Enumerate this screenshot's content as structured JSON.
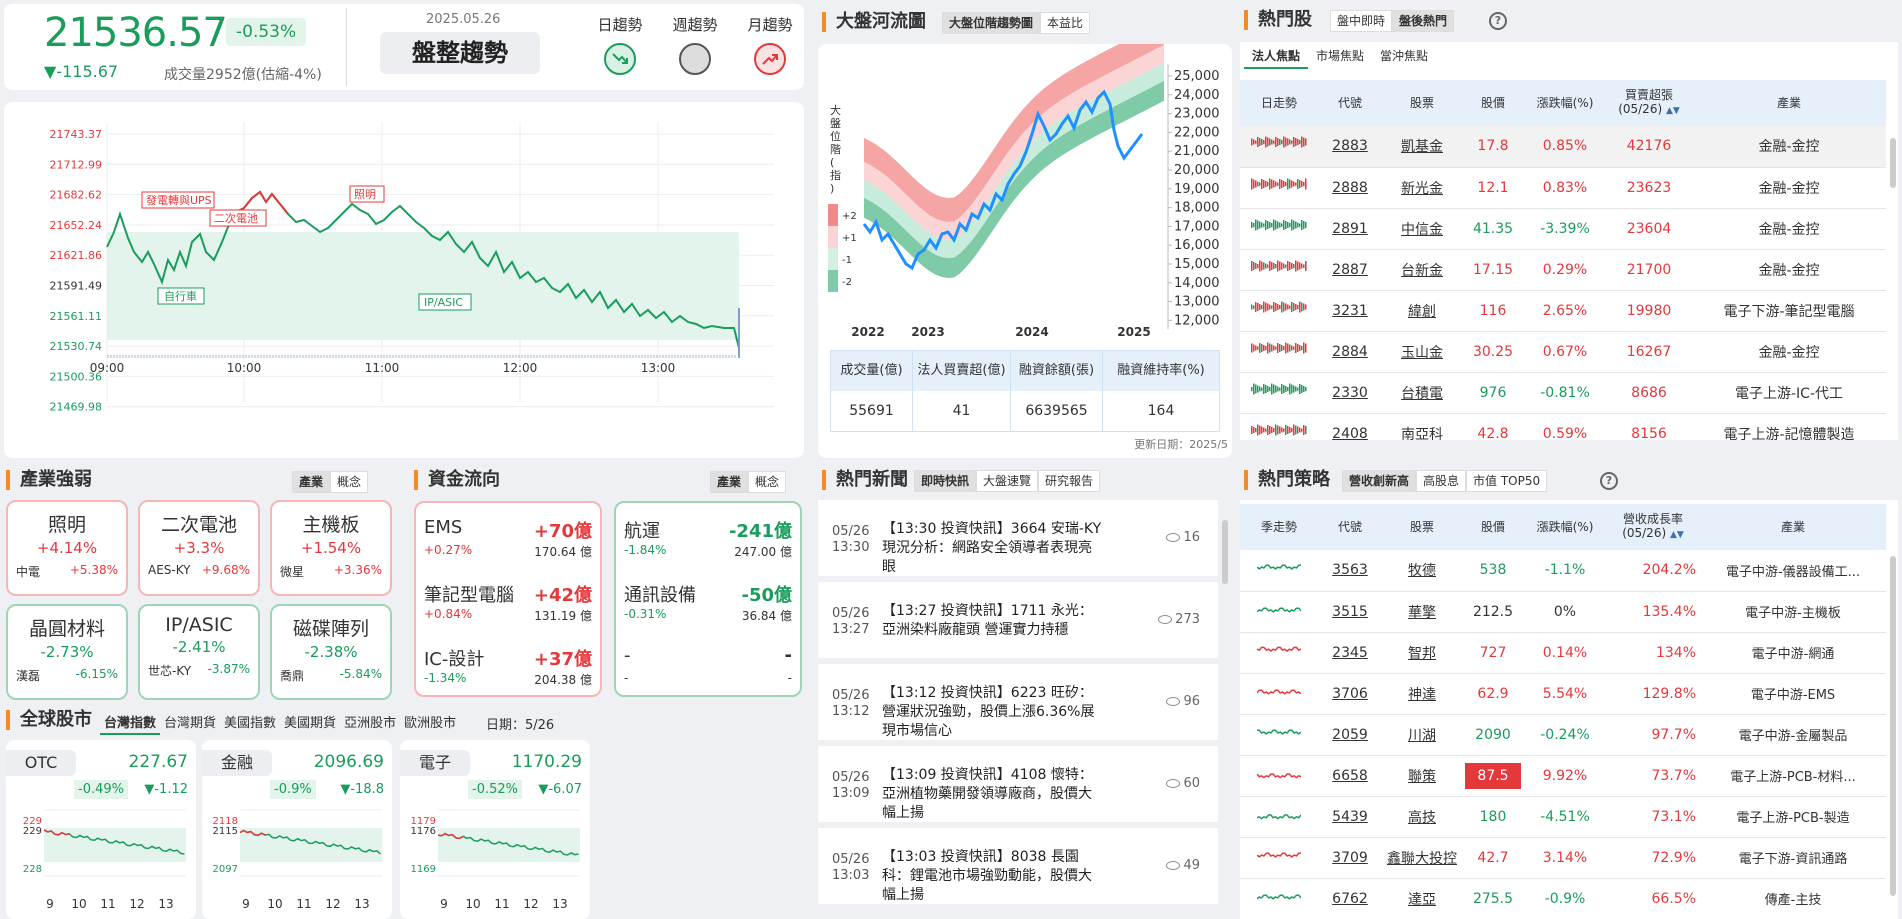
{
  "index": {
    "value": "21536.57",
    "pct": "-0.53%",
    "change": "▼-115.67",
    "volume": "成交量2952億(估縮-4%)",
    "date": "2025.05.26",
    "trend": "盤整趨勢",
    "trend_labels": [
      "日趨勢",
      "週趨勢",
      "月趨勢"
    ]
  },
  "intraday": {
    "y_ticks": [
      "21743.37",
      "21712.99",
      "21682.62",
      "21652.24",
      "21621.86",
      "21591.49",
      "21561.11",
      "21530.74",
      "21500.36",
      "21469.98"
    ],
    "x_ticks": [
      "09:00",
      "10:00",
      "11:00",
      "12:00",
      "13:00"
    ],
    "annotations": [
      "發電轉與UPS",
      "二次電池",
      "照明",
      "自行車",
      "IP/ASIC"
    ]
  },
  "river": {
    "title": "大盤河流圖",
    "tabs": [
      "大盤位階趨勢圖",
      "本益比"
    ],
    "ylabel_chars": [
      "大",
      "盤",
      "位",
      "階",
      "(",
      "指",
      ")"
    ],
    "band_labels": [
      "+2",
      "+1",
      "-1",
      "-2"
    ],
    "y_ticks": [
      "25,000",
      "24,000",
      "23,000",
      "22,000",
      "21,000",
      "20,000",
      "19,000",
      "18,000",
      "17,000",
      "16,000",
      "15,000",
      "14,000",
      "13,000",
      "12,000"
    ],
    "x_ticks": [
      "2022",
      "2023",
      "2024",
      "2025"
    ],
    "table_headers": [
      "成交量(億)",
      "法人買賣超(億)",
      "融資餘額(張)",
      "融資維持率(%)"
    ],
    "table_values": [
      "55691",
      "41",
      "6639565",
      "164"
    ],
    "updated": "更新日期：2025/5"
  },
  "hot": {
    "title": "熱門股",
    "tabs": [
      "盤中即時",
      "盤後熱門"
    ],
    "subtabs": [
      "法人焦點",
      "市場焦點",
      "當沖焦點"
    ],
    "headers": [
      "日走勢",
      "代號",
      "股票",
      "股價",
      "漲跌幅(%)",
      "買賣超張\n(05/26)",
      "產業"
    ],
    "rows": [
      {
        "code": "2883",
        "name": "凱基金",
        "price": "17.8",
        "pct": "0.85%",
        "net": "42176",
        "ind": "金融-金控",
        "dir": "up"
      },
      {
        "code": "2888",
        "name": "新光金",
        "price": "12.1",
        "pct": "0.83%",
        "net": "23623",
        "ind": "金融-金控",
        "dir": "up"
      },
      {
        "code": "2891",
        "name": "中信金",
        "price": "41.35",
        "pct": "-3.39%",
        "net": "23604",
        "ind": "金融-金控",
        "dir": "dn"
      },
      {
        "code": "2887",
        "name": "台新金",
        "price": "17.15",
        "pct": "0.29%",
        "net": "21700",
        "ind": "金融-金控",
        "dir": "up"
      },
      {
        "code": "3231",
        "name": "緯創",
        "price": "116",
        "pct": "2.65%",
        "net": "19980",
        "ind": "電子下游-筆記型電腦",
        "dir": "up"
      },
      {
        "code": "2884",
        "name": "玉山金",
        "price": "30.25",
        "pct": "0.67%",
        "net": "16267",
        "ind": "金融-金控",
        "dir": "up"
      },
      {
        "code": "2330",
        "name": "台積電",
        "price": "976",
        "pct": "-0.81%",
        "net": "8686",
        "ind": "電子上游-IC-代工",
        "dir": "dn"
      },
      {
        "code": "2408",
        "name": "南亞科",
        "price": "42.8",
        "pct": "0.59%",
        "net": "8156",
        "ind": "電子上游-記憶體製造",
        "dir": "up"
      }
    ]
  },
  "industry": {
    "title": "產業強弱",
    "tabs": [
      "產業",
      "概念"
    ],
    "items": [
      {
        "name": "照明",
        "pct": "+4.14%",
        "stock": "中電",
        "spct": "+5.38%",
        "dir": "up"
      },
      {
        "name": "二次電池",
        "pct": "+3.3%",
        "stock": "AES-KY",
        "spct": "+9.68%",
        "dir": "up"
      },
      {
        "name": "主機板",
        "pct": "+1.54%",
        "stock": "微星",
        "spct": "+3.36%",
        "dir": "up"
      },
      {
        "name": "晶圓材料",
        "pct": "-2.73%",
        "stock": "漢磊",
        "spct": "-6.15%",
        "dir": "dn"
      },
      {
        "name": "IP/ASIC",
        "pct": "-2.41%",
        "stock": "世芯-KY",
        "spct": "-3.87%",
        "dir": "dn"
      },
      {
        "name": "磁碟陣列",
        "pct": "-2.38%",
        "stock": "喬鼎",
        "spct": "-5.84%",
        "dir": "dn"
      }
    ]
  },
  "fund": {
    "title": "資金流向",
    "tabs": [
      "產業",
      "概念"
    ],
    "left": [
      {
        "name": "EMS",
        "val": "+70億",
        "pct": "+0.27%",
        "amt": "170.64 億"
      },
      {
        "name": "筆記型電腦",
        "val": "+42億",
        "pct": "+0.84%",
        "amt": "131.19 億"
      },
      {
        "name": "IC-設計",
        "val": "+37億",
        "pct": "-1.34%",
        "amt": "204.38 億"
      }
    ],
    "right": [
      {
        "name": "航運",
        "val": "-241億",
        "pct": "-1.84%",
        "amt": "247.00 億"
      },
      {
        "name": "通訊設備",
        "val": "-50億",
        "pct": "-0.31%",
        "amt": "36.84 億"
      },
      {
        "name": "-",
        "val": "-",
        "pct": "-",
        "amt": "-"
      }
    ]
  },
  "global": {
    "title": "全球股市",
    "tabs": [
      "台灣指數",
      "台灣期貨",
      "美國指數",
      "美國期貨",
      "亞洲股市",
      "歐洲股市"
    ],
    "date": "日期：5/26",
    "cards": [
      {
        "name": "OTC",
        "val": "227.67",
        "pct": "-0.49%",
        "chg": "▼-1.12",
        "ymax": "229",
        "ymid": "229",
        "ymin": "228"
      },
      {
        "name": "金融",
        "val": "2096.69",
        "pct": "-0.9%",
        "chg": "▼-18.8",
        "ymax": "2118",
        "ymid": "2115",
        "ymin": "2097"
      },
      {
        "name": "電子",
        "val": "1170.29",
        "pct": "-0.52%",
        "chg": "▼-6.07",
        "ymax": "1179",
        "ymid": "1176",
        "ymin": "1169"
      }
    ],
    "x_ticks": [
      "9",
      "10",
      "11",
      "12",
      "13"
    ]
  },
  "news": {
    "title": "熱門新聞",
    "tabs": [
      "即時快訊",
      "大盤速覽",
      "研究報告"
    ],
    "items": [
      {
        "date": "05/26",
        "time": "13:30",
        "title": "【13:30 投資快訊】3664 安瑞-KY 現況分析：網路安全領導者表現亮眼",
        "views": "16"
      },
      {
        "date": "05/26",
        "time": "13:27",
        "title": "【13:27 投資快訊】1711 永光：亞洲染料廠龍頭 營運實力持穩",
        "views": "273"
      },
      {
        "date": "05/26",
        "time": "13:12",
        "title": "【13:12 投資快訊】6223 旺矽：營運狀況強勁，股價上漲6.36%展現市場信心",
        "views": "96"
      },
      {
        "date": "05/26",
        "time": "13:09",
        "title": "【13:09 投資快訊】4108 懷特：亞洲植物藥開發領導廠商，股價大幅上揚",
        "views": "60"
      },
      {
        "date": "05/26",
        "time": "13:03",
        "title": "【13:03 投資快訊】8038 長園科：鋰電池市場強勁動能，股價大幅上揚",
        "views": "49"
      }
    ]
  },
  "strategy": {
    "title": "熱門策略",
    "tabs": [
      "營收創新高",
      "高股息",
      "市值 TOP50"
    ],
    "headers": [
      "季走勢",
      "代號",
      "股票",
      "股價",
      "漲跌幅(%)",
      "營收成長率\n(05/26)",
      "產業"
    ],
    "rows": [
      {
        "code": "3563",
        "name": "牧德",
        "price": "538",
        "pct": "-1.1%",
        "growth": "204.2%",
        "ind": "電子中游-儀器設備工...",
        "dir": "dn"
      },
      {
        "code": "3515",
        "name": "華擎",
        "price": "212.5",
        "pct": "0%",
        "growth": "135.4%",
        "ind": "電子中游-主機板",
        "dir": "flat"
      },
      {
        "code": "2345",
        "name": "智邦",
        "price": "727",
        "pct": "0.14%",
        "growth": "134%",
        "ind": "電子中游-網通",
        "dir": "up"
      },
      {
        "code": "3706",
        "name": "神達",
        "price": "62.9",
        "pct": "5.54%",
        "growth": "129.8%",
        "ind": "電子中游-EMS",
        "dir": "up"
      },
      {
        "code": "2059",
        "name": "川湖",
        "price": "2090",
        "pct": "-0.24%",
        "growth": "97.7%",
        "ind": "電子中游-金屬製品",
        "dir": "dn"
      },
      {
        "code": "6658",
        "name": "聯策",
        "price": "87.5",
        "pct": "9.92%",
        "growth": "73.7%",
        "ind": "電子上游-PCB-材料...",
        "dir": "limit"
      },
      {
        "code": "5439",
        "name": "高技",
        "price": "180",
        "pct": "-4.51%",
        "growth": "73.1%",
        "ind": "電子上游-PCB-製造",
        "dir": "dn"
      },
      {
        "code": "3709",
        "name": "鑫聯大投控",
        "price": "42.7",
        "pct": "3.14%",
        "growth": "72.9%",
        "ind": "電子下游-資訊通路",
        "dir": "up"
      },
      {
        "code": "6762",
        "name": "達亞",
        "price": "275.5",
        "pct": "-0.9%",
        "growth": "66.5%",
        "ind": "傳產-主技",
        "dir": "dn"
      }
    ]
  },
  "colors": {
    "up": "#e5383b",
    "down": "#1a9c5b",
    "accent": "#f28c28"
  }
}
